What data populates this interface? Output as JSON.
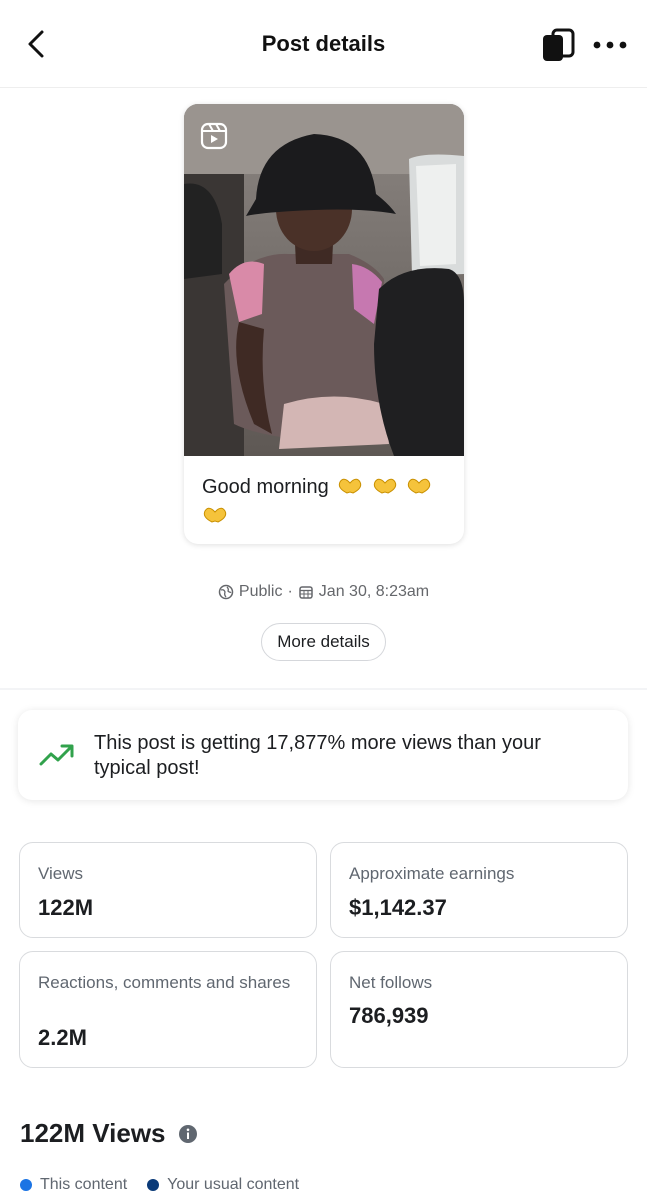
{
  "header": {
    "title": "Post details",
    "back_icon": "chevron-left-icon",
    "share_icon": "share-screen-icon",
    "more_icon": "more-horizontal-icon"
  },
  "post": {
    "caption": "Good morning",
    "caption_emoji": "🫶",
    "badge_icon": "reels-icon",
    "visibility": "Public",
    "separator": "·",
    "date": "Jan 30, 8:23am",
    "more_details_label": "More details"
  },
  "insight": {
    "text": "This post is getting 17,877% more views than your typical post!",
    "icon": "trending-up-icon",
    "accent": "#31a24c"
  },
  "stats": [
    {
      "label": "Views",
      "value": "122M"
    },
    {
      "label": "Approximate earnings",
      "value": "$1,142.37"
    },
    {
      "label": "Reactions, comments and shares",
      "value": "2.2M"
    },
    {
      "label": "Net follows",
      "value": "786,939"
    }
  ],
  "views_section": {
    "heading": "122M Views",
    "info_icon": "info-icon",
    "legend": [
      {
        "label": "This content",
        "color": "#1b74e4"
      },
      {
        "label": "Your usual content",
        "color": "#0a3a78"
      }
    ]
  }
}
